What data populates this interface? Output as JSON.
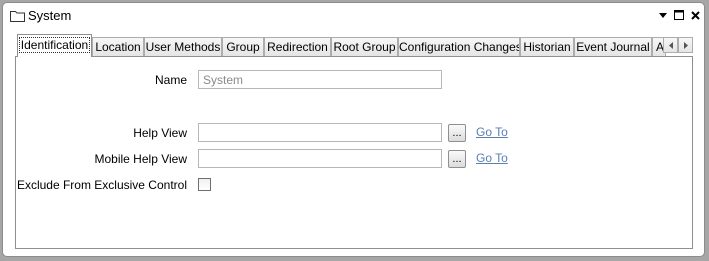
{
  "window": {
    "title": "System",
    "controls": {
      "dropdown": "▾",
      "maximize": "□",
      "close": "✕"
    }
  },
  "tabs": [
    {
      "label": "Identification",
      "active": true
    },
    {
      "label": "Location"
    },
    {
      "label": "User Methods"
    },
    {
      "label": "Group"
    },
    {
      "label": "Redirection"
    },
    {
      "label": "Root Group"
    },
    {
      "label": "Configuration Changes"
    },
    {
      "label": "Historian"
    },
    {
      "label": "Event Journal"
    },
    {
      "label": "A"
    }
  ],
  "tab_scroll": {
    "left": "◂",
    "right": "▸"
  },
  "form": {
    "name": {
      "label": "Name",
      "value": "System"
    },
    "help_view": {
      "label": "Help View",
      "value": "",
      "browse": "...",
      "goto": "Go To"
    },
    "mobile_help_view": {
      "label": "Mobile Help View",
      "value": "",
      "browse": "...",
      "goto": "Go To"
    },
    "exclude_control": {
      "label": "Exclude From Exclusive Control",
      "checked": false
    }
  },
  "colors": {
    "link": "#5a7fb5",
    "background": "#a6a6a6"
  }
}
